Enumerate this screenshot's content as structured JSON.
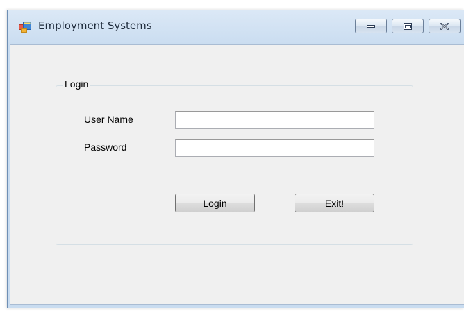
{
  "window": {
    "title": "Employment Systems",
    "app_icon": "windows-form-icon",
    "controls": {
      "minimize_icon": "minimize-icon",
      "maximize_icon": "maximize-icon",
      "close_icon": "close-icon"
    }
  },
  "login_group": {
    "legend": "Login",
    "username": {
      "label": "User Name",
      "value": "",
      "placeholder": ""
    },
    "password": {
      "label": "Password",
      "value": "",
      "placeholder": ""
    },
    "login_button": "Login",
    "exit_button": "Exit!"
  },
  "colors": {
    "title_bar": "#c9dcf0",
    "form_background": "#f0f0f0",
    "button_border": "#707070"
  }
}
